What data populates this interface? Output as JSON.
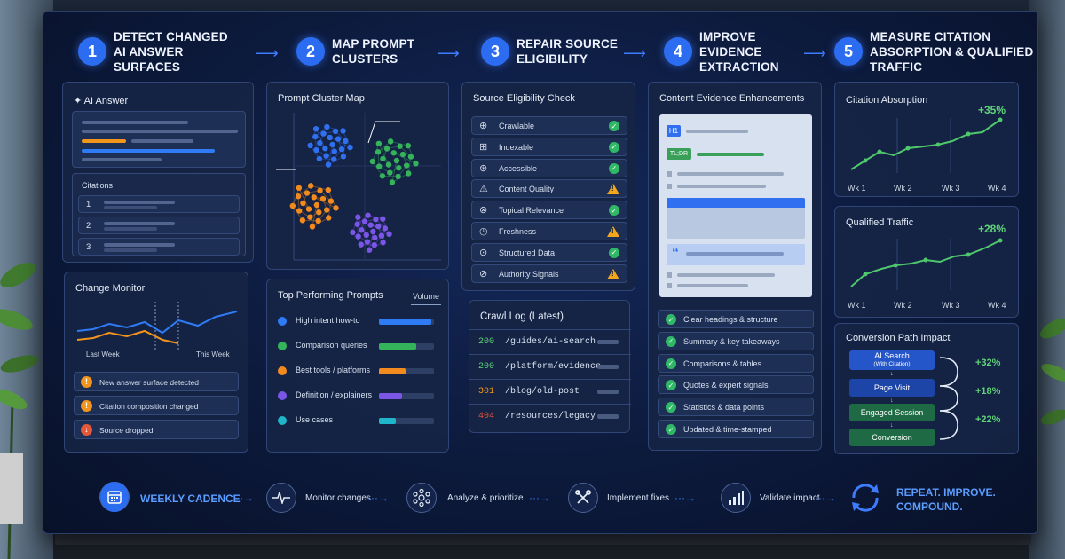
{
  "steps": [
    {
      "num": "1",
      "title": "DETECT CHANGED AI ANSWER SURFACES"
    },
    {
      "num": "2",
      "title": "MAP PROMPT CLUSTERS"
    },
    {
      "num": "3",
      "title": "REPAIR SOURCE ELIGIBILITY"
    },
    {
      "num": "4",
      "title": "IMPROVE EVIDENCE EXTRACTION"
    },
    {
      "num": "5",
      "title": "MEASURE CITATION ABSORPTION & QUALIFIED TRAFFIC"
    }
  ],
  "ai_answer": {
    "title": "AI Answer",
    "citations_label": "Citations",
    "citations": [
      "1",
      "2",
      "3"
    ]
  },
  "change_monitor": {
    "title": "Change Monitor",
    "x_labels": [
      "Last Week",
      "This Week"
    ],
    "alerts": [
      {
        "text": "New answer surface detected",
        "color": "#f2951d",
        "icon": "exclamation-icon"
      },
      {
        "text": "Citation composition changed",
        "color": "#f2951d",
        "icon": "exclamation-icon"
      },
      {
        "text": "Source dropped",
        "color": "#e4583a",
        "icon": "down-arrow-icon"
      }
    ]
  },
  "cluster_map": {
    "title": "Prompt Cluster Map"
  },
  "top_prompts": {
    "title": "Top Performing Prompts",
    "column": "Volume",
    "items": [
      {
        "label": "High intent how-to",
        "color": "#2f7bf5",
        "value": 0.95
      },
      {
        "label": "Comparison queries",
        "color": "#35b35a",
        "value": 0.68
      },
      {
        "label": "Best tools / platforms",
        "color": "#f28a1d",
        "value": 0.48
      },
      {
        "label": "Definition / explainers",
        "color": "#7a55e6",
        "value": 0.42
      },
      {
        "label": "Use cases",
        "color": "#1fb6c9",
        "value": 0.3
      }
    ]
  },
  "eligibility": {
    "title": "Source Eligibility Check",
    "items": [
      {
        "label": "Crawlable",
        "status": "ok",
        "icon": "crawl-icon"
      },
      {
        "label": "Indexable",
        "status": "ok",
        "icon": "index-icon"
      },
      {
        "label": "Accessible",
        "status": "ok",
        "icon": "accessibility-icon"
      },
      {
        "label": "Content Quality",
        "status": "warn",
        "icon": "quality-icon"
      },
      {
        "label": "Topical Relevance",
        "status": "ok",
        "icon": "target-icon"
      },
      {
        "label": "Freshness",
        "status": "warn",
        "icon": "clock-icon"
      },
      {
        "label": "Structured Data",
        "status": "ok",
        "icon": "structure-icon"
      },
      {
        "label": "Authority Signals",
        "status": "warn",
        "icon": "authority-icon"
      }
    ]
  },
  "crawl_log": {
    "title": "Crawl Log (Latest)",
    "rows": [
      {
        "code": "200",
        "path": "/guides/ai-search",
        "color": "#5fd37a"
      },
      {
        "code": "200",
        "path": "/platform/evidence",
        "color": "#5fd37a"
      },
      {
        "code": "301",
        "path": "/blog/old-post",
        "color": "#f2951d"
      },
      {
        "code": "404",
        "path": "/resources/legacy",
        "color": "#e4583a"
      }
    ]
  },
  "evidence": {
    "title": "Content Evidence Enhancements",
    "h1": "H1",
    "tldr": "TL;DR",
    "quote": "“",
    "items": [
      "Clear headings & structure",
      "Summary & key takeaways",
      "Comparisons & tables",
      "Quotes & expert signals",
      "Statistics & data points",
      "Updated & time-stamped"
    ]
  },
  "citation_absorption": {
    "title": "Citation Absorption",
    "delta": "+35%",
    "weeks": [
      "Wk 1",
      "Wk 2",
      "Wk 3",
      "Wk 4"
    ]
  },
  "qualified_traffic": {
    "title": "Qualified Traffic",
    "delta": "+28%",
    "weeks": [
      "Wk 1",
      "Wk 2",
      "Wk 3",
      "Wk 4"
    ]
  },
  "conversion": {
    "title": "Conversion Path Impact",
    "stages": [
      {
        "label": "AI Search",
        "sub": "(With Citation)",
        "color": "#2456c9"
      },
      {
        "label": "Page Visit",
        "sub": "",
        "color": "#1d45a8"
      },
      {
        "label": "Engaged Session",
        "sub": "",
        "color": "#1d6a44"
      },
      {
        "label": "Conversion",
        "sub": "",
        "color": "#1d6a44"
      }
    ],
    "deltas": [
      "+32%",
      "+18%",
      "+22%"
    ]
  },
  "cadence": {
    "label": "WEEKLY CADENCE",
    "steps": [
      {
        "label": "Monitor changes",
        "icon": "pulse-icon"
      },
      {
        "label": "Analyze & prioritize",
        "icon": "network-icon"
      },
      {
        "label": "Implement fixes",
        "icon": "tools-icon"
      },
      {
        "label": "Validate impact",
        "icon": "bar-chart-icon"
      }
    ],
    "end_line1": "REPEAT. IMPROVE.",
    "end_line2": "COMPOUND."
  }
}
